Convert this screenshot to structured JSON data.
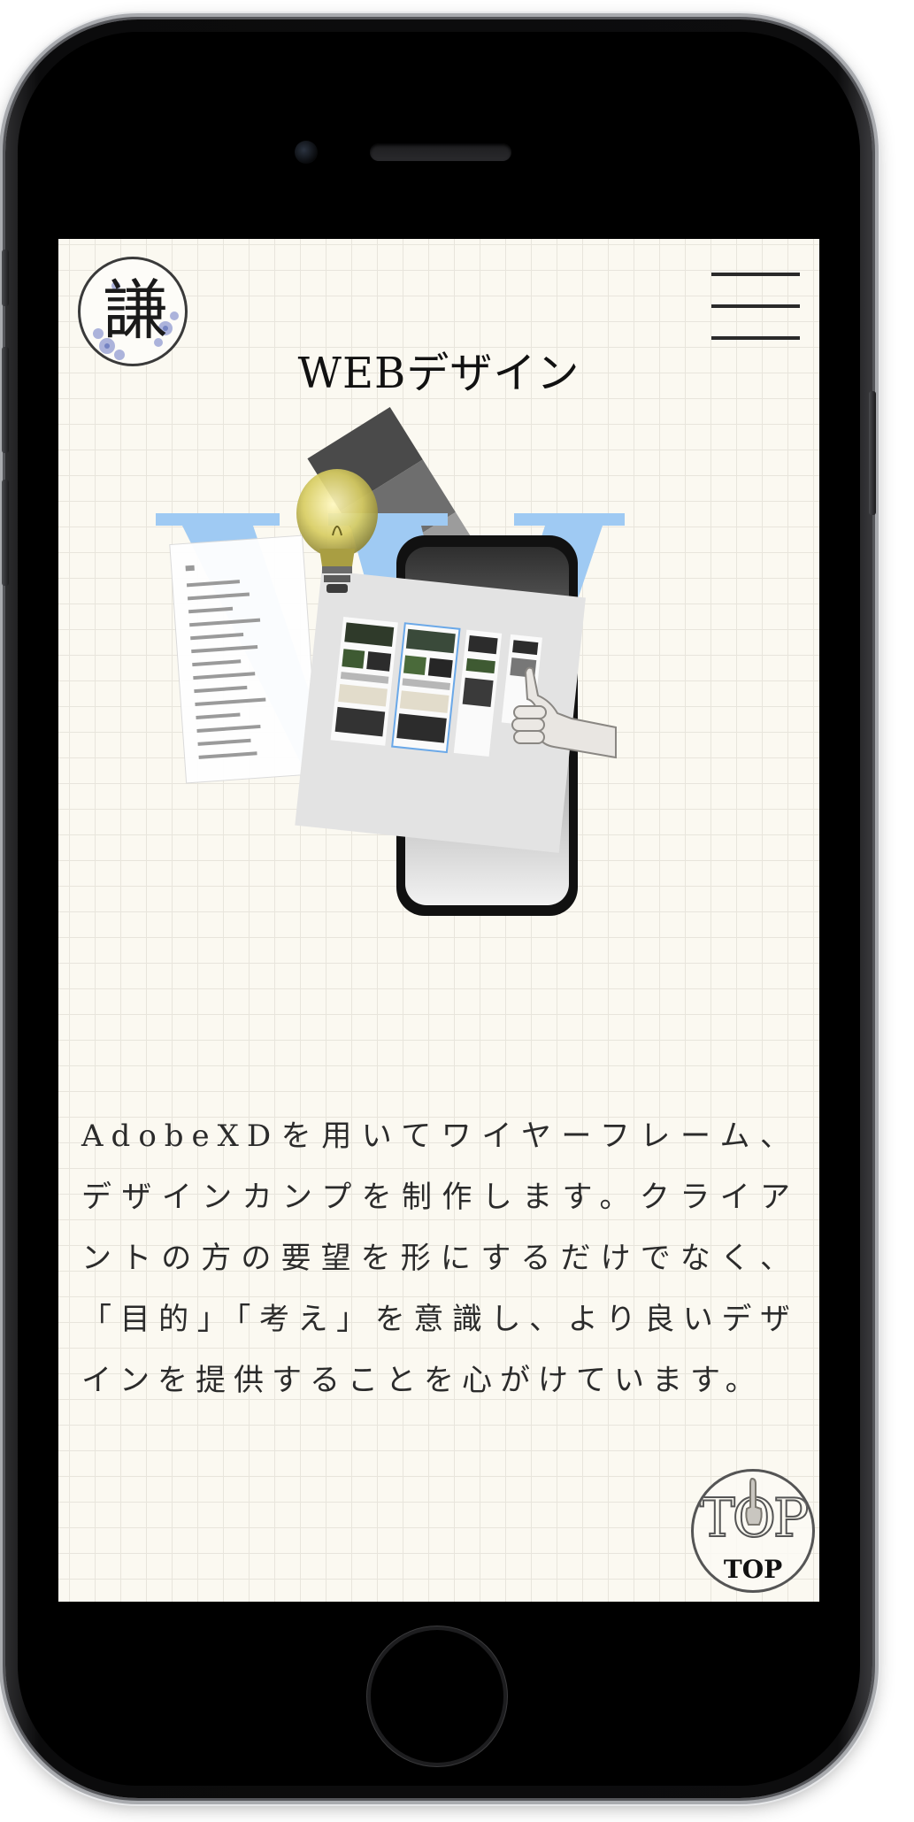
{
  "header": {
    "logo_char": "謙",
    "menu_icon": "hamburger-menu-icon"
  },
  "main": {
    "title": "WEBデザイン",
    "hero_letter": "W",
    "description": "AdobeXDを用いてワイヤーフレーム、デザインカンプを制作します。クライアントの方の要望を形にするだけでなく、「目的」「考え」を意識し、より良いデザインを提供することを心がけています。"
  },
  "top_button": {
    "outline_label": "TOP",
    "label": "TOP",
    "icon": "pointing-hand-icon"
  },
  "colors": {
    "background": "#fbf9f1",
    "grid": "#e8e5dc",
    "hero_letter": "#9fcaf3",
    "text": "#2b2b2b",
    "phone_body": "#0d0d0e"
  }
}
